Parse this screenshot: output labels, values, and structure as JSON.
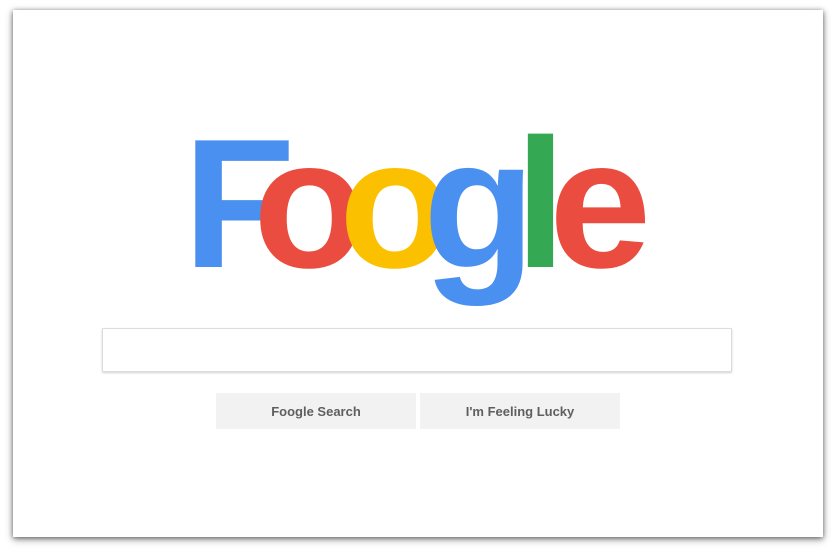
{
  "logo": {
    "text": "Foogle",
    "letters": [
      {
        "char": "F",
        "color": "#4a90f0"
      },
      {
        "char": "o",
        "color": "#ea4c3f"
      },
      {
        "char": "o",
        "color": "#fbc100"
      },
      {
        "char": "g",
        "color": "#4a90f0"
      },
      {
        "char": "l",
        "color": "#34a853"
      },
      {
        "char": "e",
        "color": "#ea4c3f"
      }
    ]
  },
  "search": {
    "value": "",
    "placeholder": ""
  },
  "buttons": {
    "search_label": "Foogle Search",
    "lucky_label": "I'm Feeling Lucky"
  },
  "colors": {
    "button_bg": "#f2f2f2",
    "button_text": "#5f5f5f",
    "background": "#ffffff"
  }
}
